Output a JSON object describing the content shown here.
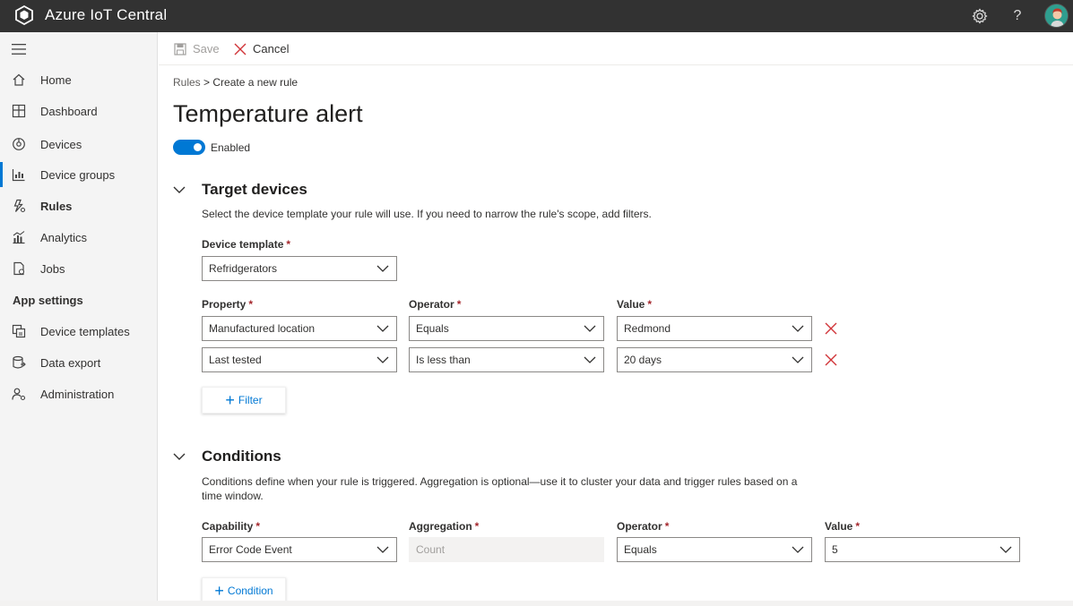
{
  "app": {
    "title": "Azure IoT Central",
    "icons": {
      "logo": "azure-iot-logo",
      "settings": "gear-icon",
      "help": "help-icon",
      "avatar": "user-avatar"
    },
    "help_glyph": "?"
  },
  "sidebar": {
    "items": [
      {
        "label": "Home",
        "icon": "home-icon"
      },
      {
        "label": "Dashboard",
        "icon": "dashboard-icon"
      },
      {
        "label": "Devices",
        "icon": "devices-icon"
      },
      {
        "label": "Device groups",
        "icon": "device-groups-icon"
      },
      {
        "label": "Rules",
        "icon": "rules-icon"
      },
      {
        "label": "Analytics",
        "icon": "analytics-icon"
      },
      {
        "label": "Jobs",
        "icon": "jobs-icon"
      }
    ],
    "section_heading": "App settings",
    "settings_items": [
      {
        "label": "Device templates",
        "icon": "device-templates-icon"
      },
      {
        "label": "Data export",
        "icon": "data-export-icon"
      },
      {
        "label": "Administration",
        "icon": "administration-icon"
      }
    ]
  },
  "toolbar": {
    "save_label": "Save",
    "cancel_label": "Cancel"
  },
  "breadcrumb": {
    "root": "Rules",
    "separator": ">",
    "current": "Create a new rule"
  },
  "page": {
    "title": "Temperature alert",
    "toggle_label": "Enabled",
    "enabled": true
  },
  "target_devices": {
    "title": "Target devices",
    "description": "Select the device template your rule  will use. If you need to narrow the rule's scope, add filters.",
    "template_label": "Device template",
    "template_value": "Refridgerators",
    "property_label": "Property",
    "operator_label": "Operator",
    "value_label": "Value",
    "filters": [
      {
        "property": "Manufactured location",
        "operator": "Equals",
        "value": "Redmond"
      },
      {
        "property": "Last tested",
        "operator": "Is less than",
        "value": "20 days"
      }
    ],
    "add_filter_label": "Filter"
  },
  "conditions": {
    "title": "Conditions",
    "description": "Conditions define when your rule is triggered. Aggregation is optional—use it to cluster your data and trigger rules based on a time window.",
    "capability_label": "Capability",
    "aggregation_label": "Aggregation",
    "operator_label": "Operator",
    "value_label": "Value",
    "row": {
      "capability": "Error Code Event",
      "aggregation_placeholder": "Count",
      "operator": "Equals",
      "value": "5"
    },
    "add_condition_label": "Condition"
  },
  "colors": {
    "accent": "#0078d4",
    "topbar": "#323232",
    "delete": "#d13438",
    "required": "#a4262c"
  }
}
